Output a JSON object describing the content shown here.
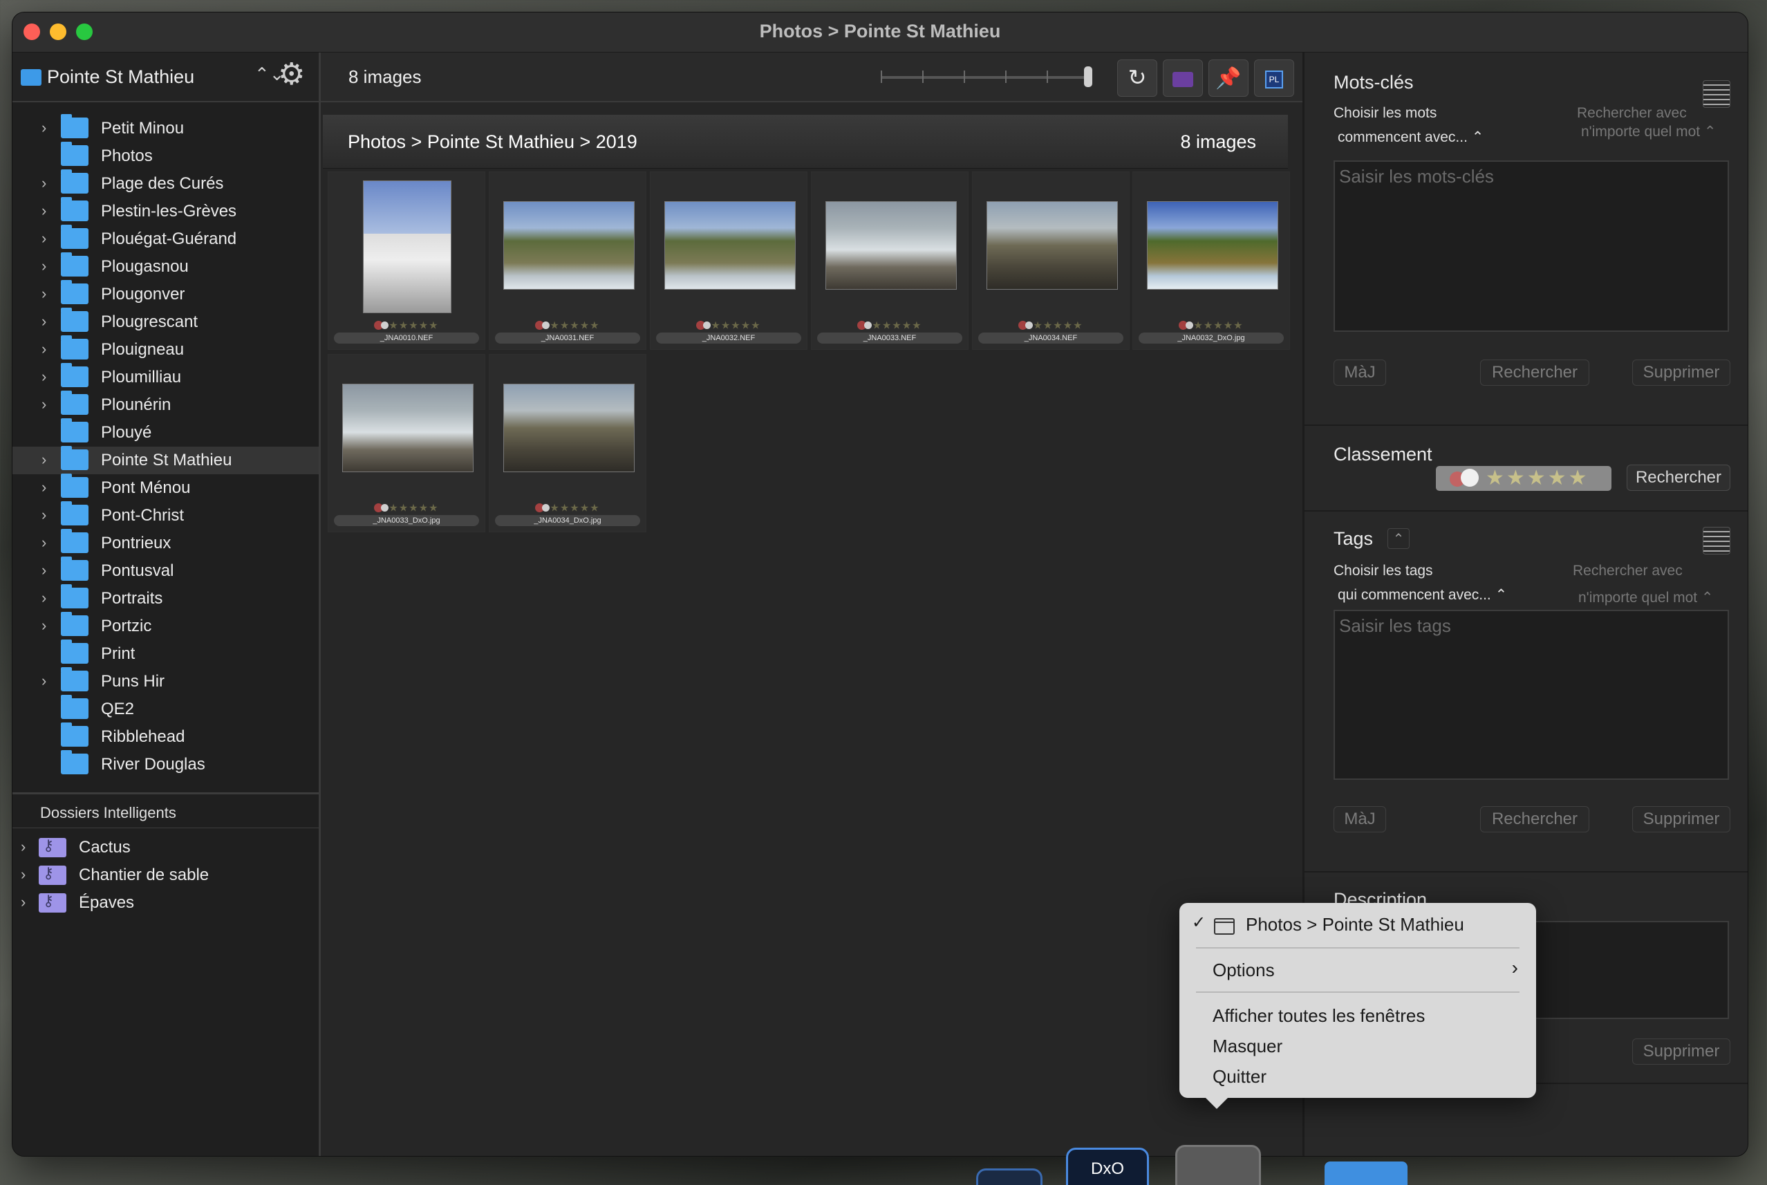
{
  "window": {
    "title": "Photos > Pointe St Mathieu"
  },
  "sidebar": {
    "source": "Pointe St Mathieu",
    "folders": [
      {
        "label": "Petit Minou",
        "expandable": true
      },
      {
        "label": "Photos",
        "expandable": false
      },
      {
        "label": "Plage des Curés",
        "expandable": true
      },
      {
        "label": "Plestin-les-Grèves",
        "expandable": true
      },
      {
        "label": "Plouégat-Guérand",
        "expandable": true
      },
      {
        "label": "Plougasnou",
        "expandable": true
      },
      {
        "label": "Plougonver",
        "expandable": true
      },
      {
        "label": "Plougrescant",
        "expandable": true
      },
      {
        "label": "Plouigneau",
        "expandable": true
      },
      {
        "label": "Ploumilliau",
        "expandable": true
      },
      {
        "label": "Plounérin",
        "expandable": true
      },
      {
        "label": "Plouyé",
        "expandable": false
      },
      {
        "label": "Pointe St Mathieu",
        "expandable": true,
        "selected": true
      },
      {
        "label": "Pont Ménou",
        "expandable": true
      },
      {
        "label": "Pont-Christ",
        "expandable": true
      },
      {
        "label": "Pontrieux",
        "expandable": true
      },
      {
        "label": "Pontusval",
        "expandable": true
      },
      {
        "label": "Portraits",
        "expandable": true
      },
      {
        "label": "Portzic",
        "expandable": true
      },
      {
        "label": "Print",
        "expandable": false
      },
      {
        "label": "Puns Hir",
        "expandable": true
      },
      {
        "label": "QE2",
        "expandable": false
      },
      {
        "label": "Ribblehead",
        "expandable": false
      },
      {
        "label": "River Douglas",
        "expandable": false
      }
    ],
    "smart_title": "Dossiers Intelligents",
    "smart_folders": [
      "Cactus",
      "Chantier de sable",
      "Épaves"
    ]
  },
  "toolbar": {
    "count": "8 images"
  },
  "browser": {
    "path": "Photos > Pointe St Mathieu > 2019",
    "count": "8 images",
    "thumbnails": [
      {
        "name": "_JNA0010.NEF",
        "kind": "lighthouse"
      },
      {
        "name": "_JNA0031.NEF",
        "kind": "cliff"
      },
      {
        "name": "_JNA0032.NEF",
        "kind": "cliff"
      },
      {
        "name": "_JNA0033.NEF",
        "kind": "sea"
      },
      {
        "name": "_JNA0034.NEF",
        "kind": "rocks"
      },
      {
        "name": "_JNA0032_DxO.jpg",
        "kind": "cliff-vivid"
      },
      {
        "name": "_JNA0033_DxO.jpg",
        "kind": "sea"
      },
      {
        "name": "_JNA0034_DxO.jpg",
        "kind": "rocks"
      }
    ],
    "stars": "★★★★★"
  },
  "keywords": {
    "title": "Mots-clés",
    "choose": "Choisir les mots",
    "mode": "commencent avec... ⌃",
    "search_with": "Rechercher avec",
    "any_word": "n'importe quel mot ⌃",
    "placeholder": "Saisir les mots-clés",
    "btn_update": "MàJ",
    "btn_search": "Rechercher",
    "btn_delete": "Supprimer"
  },
  "ranking": {
    "title": "Classement",
    "stars": "★★★★★",
    "btn_search": "Rechercher"
  },
  "tags": {
    "title": "Tags",
    "choose": "Choisir les tags",
    "mode": "qui commencent avec... ⌃",
    "search_with": "Rechercher avec",
    "any_word": "n'importe quel mot ⌃",
    "placeholder": "Saisir les tags",
    "btn_update": "MàJ",
    "btn_search": "Rechercher",
    "btn_delete": "Supprimer"
  },
  "description": {
    "title": "Description",
    "btn_delete": "Supprimer"
  },
  "context_menu": {
    "window_item": "Photos > Pointe St Mathieu",
    "options": "Options",
    "show_all": "Afficher toutes les fenêtres",
    "hide": "Masquer",
    "quit": "Quitter"
  },
  "dock": {
    "dxo_label": "DxO"
  }
}
